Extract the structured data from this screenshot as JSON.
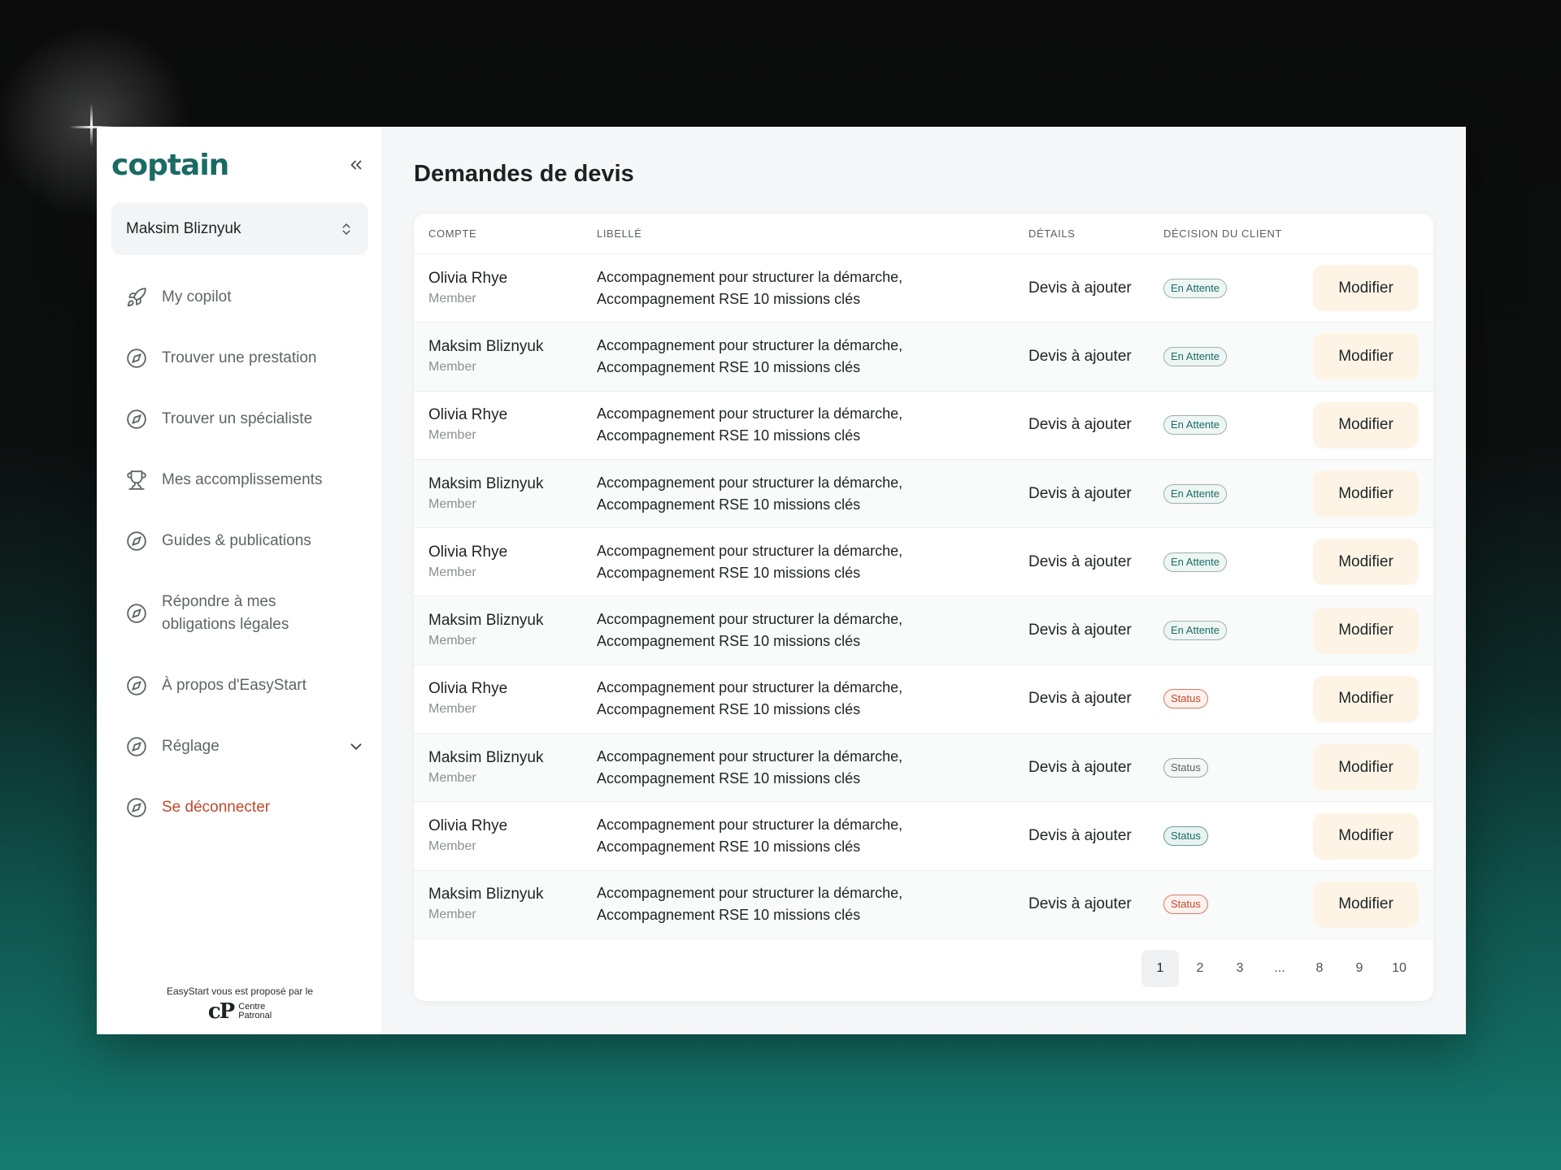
{
  "app": {
    "logo_text": "coptain"
  },
  "account": {
    "selected": "Maksim Bliznyuk"
  },
  "nav": [
    {
      "label": "My copilot",
      "icon": "rocket-icon"
    },
    {
      "label": "Trouver une prestation",
      "icon": "compass-icon"
    },
    {
      "label": "Trouver un spécialiste",
      "icon": "compass-icon"
    },
    {
      "label": "Mes accomplissements",
      "icon": "trophy-icon"
    },
    {
      "label": "Guides & publications",
      "icon": "compass-icon"
    },
    {
      "label": "Répondre à mes obligations légales",
      "icon": "compass-icon"
    },
    {
      "label": "À propos d'EasyStart",
      "icon": "compass-icon"
    },
    {
      "label": "Réglage",
      "icon": "compass-icon"
    },
    {
      "label": "Se déconnecter",
      "icon": "compass-icon"
    }
  ],
  "footer": {
    "note": "EasyStart vous est proposé par le",
    "partner_mark": "cP",
    "partner_line1": "Centre",
    "partner_line2": "Patronal"
  },
  "page": {
    "title": "Demandes de devis"
  },
  "table": {
    "headers": {
      "compte": "COMPTE",
      "libelle": "LIBELLÉ",
      "details": "DÉTAILS",
      "decision": "DÉCISION DU CLIENT"
    },
    "rows": [
      {
        "name": "Olivia Rhye",
        "role": "Member",
        "libelle1": "Accompagnement pour structurer la démarche,",
        "libelle2": "Accompagnement RSE 10 missions clés",
        "details": "Devis à ajouter",
        "badge": "En Attente",
        "badge_style": "green",
        "action": "Modifier"
      },
      {
        "name": "Maksim Bliznyuk",
        "role": "Member",
        "libelle1": "Accompagnement pour structurer la démarche,",
        "libelle2": "Accompagnement RSE 10 missions clés",
        "details": "Devis à ajouter",
        "badge": "En Attente",
        "badge_style": "green",
        "action": "Modifier"
      },
      {
        "name": "Olivia Rhye",
        "role": "Member",
        "libelle1": "Accompagnement pour structurer la démarche,",
        "libelle2": "Accompagnement RSE 10 missions clés",
        "details": "Devis à ajouter",
        "badge": "En Attente",
        "badge_style": "green",
        "action": "Modifier"
      },
      {
        "name": "Maksim Bliznyuk",
        "role": "Member",
        "libelle1": "Accompagnement pour structurer la démarche,",
        "libelle2": "Accompagnement RSE 10 missions clés",
        "details": "Devis à ajouter",
        "badge": "En Attente",
        "badge_style": "green",
        "action": "Modifier"
      },
      {
        "name": "Olivia Rhye",
        "role": "Member",
        "libelle1": "Accompagnement pour structurer la démarche,",
        "libelle2": "Accompagnement RSE 10 missions clés",
        "details": "Devis à ajouter",
        "badge": "En Attente",
        "badge_style": "green",
        "action": "Modifier"
      },
      {
        "name": "Maksim Bliznyuk",
        "role": "Member",
        "libelle1": "Accompagnement pour structurer la démarche,",
        "libelle2": "Accompagnement RSE 10 missions clés",
        "details": "Devis à ajouter",
        "badge": "En Attente",
        "badge_style": "green",
        "action": "Modifier"
      },
      {
        "name": "Olivia Rhye",
        "role": "Member",
        "libelle1": "Accompagnement pour structurer la démarche,",
        "libelle2": "Accompagnement RSE 10 missions clés",
        "details": "Devis à ajouter",
        "badge": "Status",
        "badge_style": "red",
        "action": "Modifier"
      },
      {
        "name": "Maksim Bliznyuk",
        "role": "Member",
        "libelle1": "Accompagnement pour structurer la démarche,",
        "libelle2": "Accompagnement RSE 10 missions clés",
        "details": "Devis à ajouter",
        "badge": "Status",
        "badge_style": "grey",
        "action": "Modifier"
      },
      {
        "name": "Olivia Rhye",
        "role": "Member",
        "libelle1": "Accompagnement pour structurer la démarche,",
        "libelle2": "Accompagnement RSE 10 missions clés",
        "details": "Devis à ajouter",
        "badge": "Status",
        "badge_style": "teal",
        "action": "Modifier"
      },
      {
        "name": "Maksim Bliznyuk",
        "role": "Member",
        "libelle1": "Accompagnement pour structurer la démarche,",
        "libelle2": "Accompagnement RSE 10 missions clés",
        "details": "Devis à ajouter",
        "badge": "Status",
        "badge_style": "red",
        "action": "Modifier"
      }
    ]
  },
  "pagination": {
    "pages": [
      "1",
      "2",
      "3",
      "...",
      "8",
      "9",
      "10"
    ],
    "active": "1"
  },
  "colors": {
    "brand": "#1b6b64",
    "danger": "#c0492b",
    "button_bg": "#fdf4e6"
  }
}
